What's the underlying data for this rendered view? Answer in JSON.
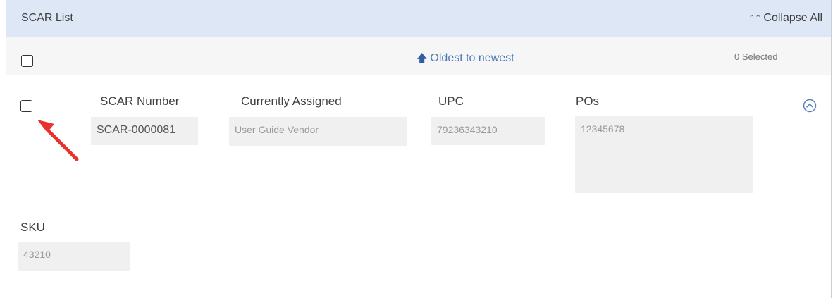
{
  "header": {
    "title": "SCAR List",
    "collapse_label": "Collapse All",
    "collapse_icon": "double-chevron-up"
  },
  "sortbar": {
    "sort_label": "Oldest to newest",
    "sort_icon": "arrow-up",
    "selected_count": "0 Selected"
  },
  "record": {
    "scar_number": {
      "label": "SCAR Number",
      "value": "SCAR-0000081"
    },
    "currently_assigned": {
      "label": "Currently Assigned",
      "value": "User Guide Vendor"
    },
    "upc": {
      "label": "UPC",
      "value": "79236343210"
    },
    "pos": {
      "label": "POs",
      "value": "12345678"
    },
    "sku": {
      "label": "SKU",
      "value": "43210"
    },
    "expand_icon": "chevron-up-circle"
  },
  "colors": {
    "header_bg": "#dde7f6",
    "link": "#4a78b6",
    "annotation_arrow": "#e8322b"
  }
}
